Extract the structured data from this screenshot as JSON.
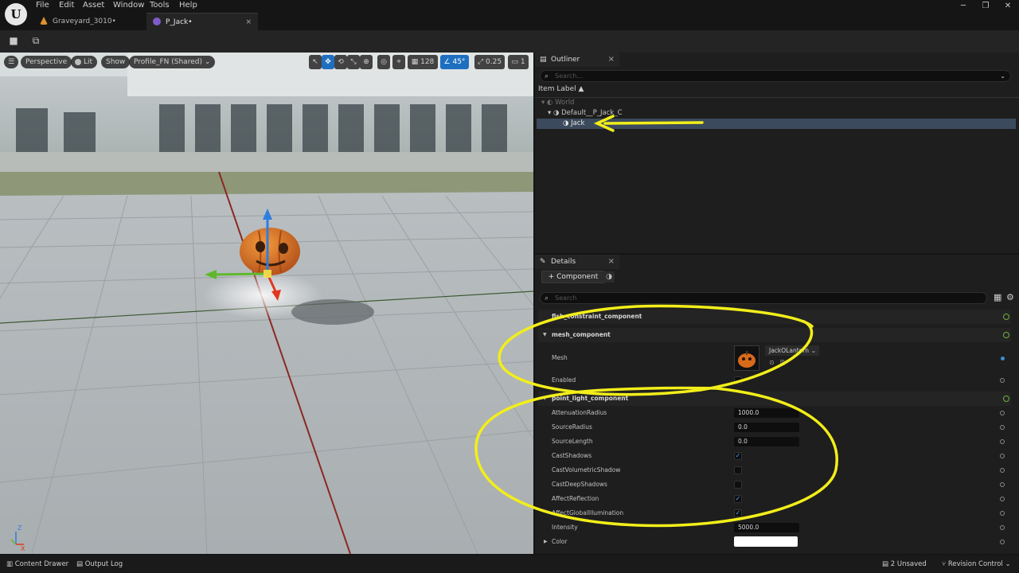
{
  "menu": [
    "File",
    "Edit",
    "Asset",
    "Window",
    "Tools",
    "Help"
  ],
  "tabs": [
    {
      "label": "Graveyard_3010•",
      "icon_color": "#e0902a"
    },
    {
      "label": "P_Jack•",
      "icon_color": "#7d5cc7"
    }
  ],
  "viewport": {
    "perspective": "Perspective",
    "lit": "Lit",
    "show": "Show",
    "profile": "Profile_FN (Shared)",
    "grid_size": "128",
    "angle": "45°",
    "scale": "0.25",
    "camera_speed": "1"
  },
  "outliner": {
    "title": "Outliner",
    "search_placeholder": "Search...",
    "column_label": "Item Label ▲",
    "items": [
      {
        "label": "World",
        "depth": 0
      },
      {
        "label": "Default__P_Jack_C",
        "depth": 1
      },
      {
        "label": "Jack",
        "depth": 2,
        "selected": true
      }
    ]
  },
  "details": {
    "title": "Details",
    "add_component": "+ Component",
    "search_placeholder": "Search",
    "categories": {
      "c1": "fish_constraint_component",
      "c2": "mesh_component",
      "c3": "point_light_component"
    },
    "mesh": {
      "label": "Mesh",
      "asset": "JackOLantern",
      "enabled_label": "Enabled"
    },
    "props": [
      {
        "label": "AttenuationRadius",
        "kind": "value",
        "value": "1000.0"
      },
      {
        "label": "SourceRadius",
        "kind": "value",
        "value": "0.0"
      },
      {
        "label": "SourceLength",
        "kind": "value",
        "value": "0.0"
      },
      {
        "label": "CastShadows",
        "kind": "check",
        "checked": true
      },
      {
        "label": "CastVolumetricShadow",
        "kind": "check",
        "checked": false
      },
      {
        "label": "CastDeepShadows",
        "kind": "check",
        "checked": false
      },
      {
        "label": "AffectReflection",
        "kind": "check",
        "checked": true
      },
      {
        "label": "AffectGlobalIllumination",
        "kind": "check",
        "checked": true
      },
      {
        "label": "Intensity",
        "kind": "value",
        "value": "5000.0"
      },
      {
        "label": "Color",
        "kind": "color",
        "value": "#ffffff"
      }
    ]
  },
  "statusbar": {
    "content_drawer": "Content Drawer",
    "output_log": "Output Log",
    "unsaved": "2 Unsaved",
    "revision_control": "Revision Control"
  },
  "colors": {
    "annotation": "#f2ee1a",
    "accent": "#1f6fc0",
    "pumpkin": "#d86a1c"
  }
}
